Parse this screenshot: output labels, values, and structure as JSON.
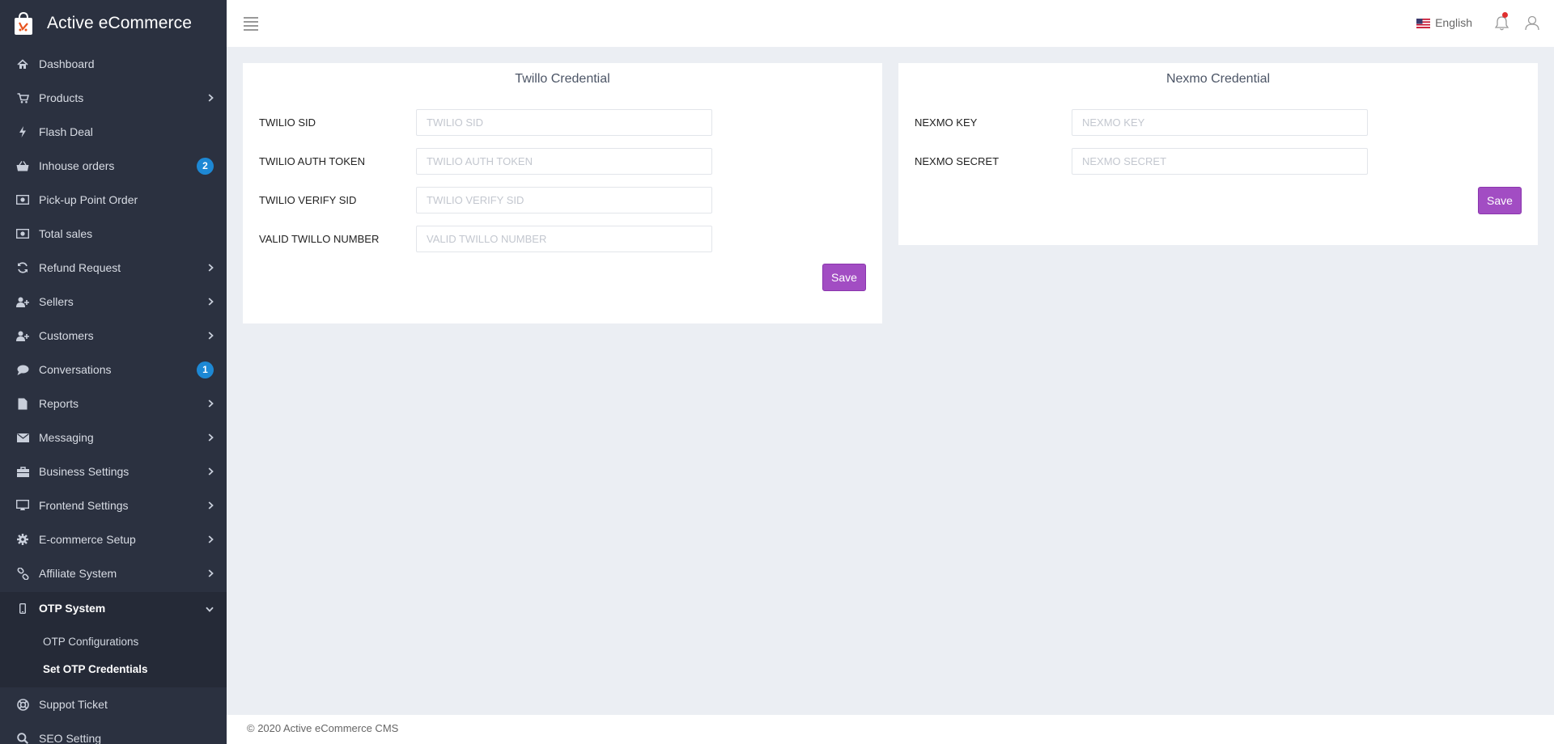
{
  "brand": {
    "name": "Active eCommerce"
  },
  "sidebar": {
    "items": [
      {
        "label": "Dashboard",
        "icon": "home-icon",
        "chevron": false,
        "badge": ""
      },
      {
        "label": "Products",
        "icon": "cart-icon",
        "chevron": true,
        "badge": ""
      },
      {
        "label": "Flash Deal",
        "icon": "bolt-icon",
        "chevron": false,
        "badge": ""
      },
      {
        "label": "Inhouse orders",
        "icon": "basket-icon",
        "chevron": false,
        "badge": "2"
      },
      {
        "label": "Pick-up Point Order",
        "icon": "money-icon",
        "chevron": false,
        "badge": ""
      },
      {
        "label": "Total sales",
        "icon": "money-icon",
        "chevron": false,
        "badge": ""
      },
      {
        "label": "Refund Request",
        "icon": "refresh-icon",
        "chevron": true,
        "badge": ""
      },
      {
        "label": "Sellers",
        "icon": "user-plus-icon",
        "chevron": true,
        "badge": ""
      },
      {
        "label": "Customers",
        "icon": "user-plus-icon",
        "chevron": true,
        "badge": ""
      },
      {
        "label": "Conversations",
        "icon": "chat-icon",
        "chevron": false,
        "badge": "1"
      },
      {
        "label": "Reports",
        "icon": "file-icon",
        "chevron": true,
        "badge": ""
      },
      {
        "label": "Messaging",
        "icon": "envelope-icon",
        "chevron": true,
        "badge": ""
      },
      {
        "label": "Business Settings",
        "icon": "briefcase-icon",
        "chevron": true,
        "badge": ""
      },
      {
        "label": "Frontend Settings",
        "icon": "desktop-icon",
        "chevron": true,
        "badge": ""
      },
      {
        "label": "E-commerce Setup",
        "icon": "gear-icon",
        "chevron": true,
        "badge": ""
      },
      {
        "label": "Affiliate System",
        "icon": "link-icon",
        "chevron": true,
        "badge": ""
      }
    ],
    "active": {
      "label": "OTP System",
      "icon": "mobile-icon"
    },
    "submenu": [
      {
        "label": "OTP Configurations"
      },
      {
        "label": "Set OTP Credentials"
      }
    ],
    "after": [
      {
        "label": "Suppot Ticket",
        "icon": "lifebuoy-icon"
      },
      {
        "label": "SEO Setting",
        "icon": "search-icon"
      }
    ]
  },
  "topbar": {
    "language": "English"
  },
  "twilio": {
    "title": "Twillo Credential",
    "fields": [
      {
        "label": "TWILIO SID",
        "placeholder": "TWILIO SID",
        "value": ""
      },
      {
        "label": "TWILIO AUTH TOKEN",
        "placeholder": "TWILIO AUTH TOKEN",
        "value": ""
      },
      {
        "label": "TWILIO VERIFY SID",
        "placeholder": "TWILIO VERIFY SID",
        "value": ""
      },
      {
        "label": "VALID TWILLO NUMBER",
        "placeholder": "VALID TWILLO NUMBER",
        "value": ""
      }
    ],
    "save_label": "Save"
  },
  "nexmo": {
    "title": "Nexmo Credential",
    "fields": [
      {
        "label": "NEXMO KEY",
        "placeholder": "NEXMO KEY",
        "value": ""
      },
      {
        "label": "NEXMO SECRET",
        "placeholder": "NEXMO SECRET",
        "value": ""
      }
    ],
    "save_label": "Save"
  },
  "footer": {
    "text": "© 2020 Active eCommerce CMS"
  },
  "colors": {
    "sidebar": "#2b3140",
    "accent": "#a24dc3",
    "badge": "#1d88d4",
    "page_bg": "#ebeef3"
  }
}
